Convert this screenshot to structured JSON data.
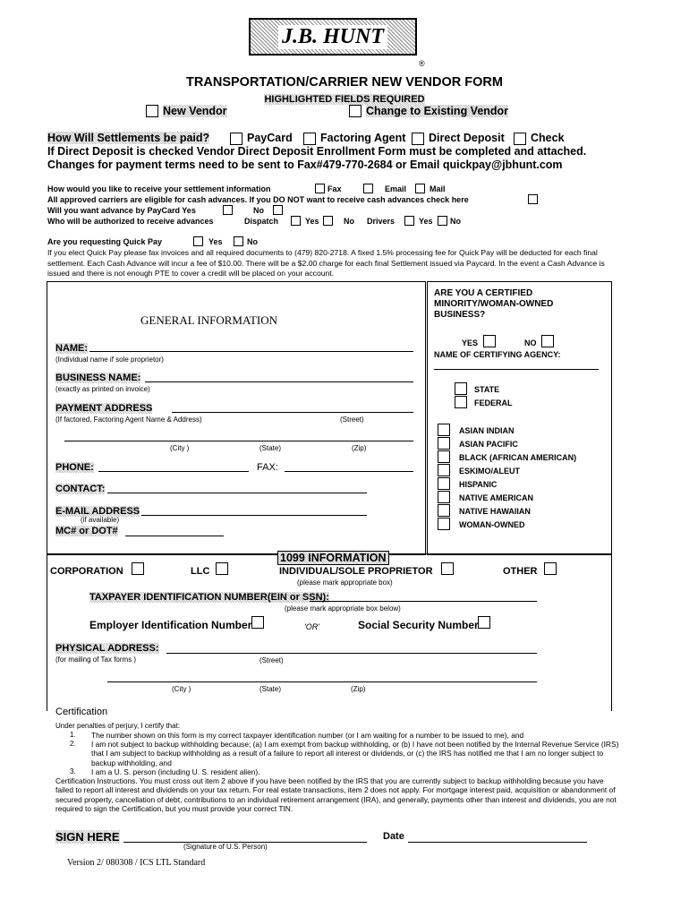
{
  "logo": {
    "text": "J.B. HUNT",
    "registered": "®"
  },
  "title": "TRANSPORTATION/CARRIER NEW VENDOR FORM",
  "highlighted_note": "HIGHLIGHTED FIELDS REQUIRED",
  "vendor_type": {
    "new": "New Vendor",
    "change": "Change to Existing Vendor"
  },
  "settlement": {
    "question": "How Will Settlements be paid?",
    "options": [
      "PayCard",
      "Factoring Agent",
      "Direct Deposit",
      "Check"
    ],
    "note1": "If Direct Deposit is checked Vendor Direct Deposit Enrollment Form must be completed and attached.",
    "note2": "Changes for payment terms need to be sent to Fax#479-770-2684 or Email quickpay@jbhunt.com"
  },
  "receive": {
    "question": "How would you like to receive your settlement information",
    "fax": "Fax",
    "email": "Email",
    "mail": "Mail"
  },
  "advances": {
    "line": "All approved carriers are eligible for cash advances. If you DO NOT want to receive cash advances check here",
    "paycard": "Will you want advance by PayCard  Yes",
    "no": "No",
    "authorized": "Who will be authorized to receive advances",
    "dispatch": "Dispatch",
    "yes": "Yes",
    "drivers": "Drivers"
  },
  "quickpay": {
    "question": "Are you requesting Quick Pay",
    "yes": "Yes",
    "no": "No",
    "text": "If you elect Quick Pay please fax invoices and all required documents to (479) 820-2718.  A fixed 1.5% processing fee for Quick Pay will be deducted for each final settlement.  Each Cash Advance will incur a fee of $10.00.  There will be a $2.00 charge for each final Settlement issued via Paycard.  In the event a Cash Advance is issued and there is not enough PTE to cover a credit will be placed on your account."
  },
  "general": {
    "heading": "GENERAL INFORMATION",
    "name": "NAME:",
    "name_hint": "(Individual name if sole proprietor)",
    "business": "BUSINESS NAME:",
    "business_hint": "(exactly as printed on invoice)",
    "payment": "PAYMENT ADDRESS",
    "payment_hint": "(If factored, Factoring Agent Name & Address)",
    "street": "(Street)",
    "city": "(City )",
    "state": "(State)",
    "zip": "(Zip)",
    "phone": "PHONE:",
    "fax": "FAX:",
    "contact": "CONTACT:",
    "email": "E-MAIL ADDRESS",
    "email_hint": "(if available)",
    "mc": "MC# or DOT#"
  },
  "minority": {
    "question": "ARE YOU A CERTIFIED MINORITY/WOMAN-OWNED BUSINESS?",
    "yes": "YES",
    "no": "NO",
    "agency": "NAME OF CERTIFYING AGENCY:",
    "levels": [
      "STATE",
      "FEDERAL"
    ],
    "groups": [
      "ASIAN INDIAN",
      "ASIAN PACIFIC",
      "BLACK (AFRICAN AMERICAN)",
      "ESKIMO/ALEUT",
      "HISPANIC",
      "NATIVE AMERICAN",
      "NATIVE HAWAIIAN",
      "WOMAN-OWNED"
    ]
  },
  "tax": {
    "heading": "1099 INFORMATION",
    "corp": "CORPORATION",
    "llc": "LLC",
    "individual": "INDIVIDUAL/SOLE PROPRIETOR",
    "other": "OTHER",
    "mark_hint": "(please mark appropriate box)",
    "tin": "TAXPAYER IDENTIFICATION NUMBER(EIN or SSN):",
    "tin_hint": "(please mark appropriate box below)",
    "ein": "Employer Identification Number",
    "or": "'OR'",
    "ssn": "Social Security Number",
    "physical": "PHYSICAL ADDRESS:",
    "physical_hint": "(for mailing of Tax forms )",
    "street": "(Street)",
    "city": "(City )",
    "state": "(State)",
    "zip": "(Zip)"
  },
  "certification": {
    "heading": "Certification",
    "intro": "Under penalties of perjury, I certify that:",
    "items": [
      "The number shown on this form is my correct taxpayer identification number (or I am waiting for a number to be issued to me), and",
      "I am not subject to backup withholding because; (a) I am exempt from backup withholding, or (b) I have not been notified by the Internal Revenue Service (IRS) that I am subject to backup withholding as a result of a failure to report all interest or dividends, or (c) the IRS has notified me that I am no longer subject to backup withholding, and",
      "I am a U. S. person (including U. S. resident alien)."
    ],
    "instructions": "Certification Instructions.  You must cross out item 2 above if you have been notified by the IRS that you are currently subject to backup withholding because you have failed to report all interest and dividends on your tax return.  For real estate transactions, item 2 does not apply.  For mortgage interest paid, acquisition or abandonment of secured property, cancellation of debt, contributions to an individual retirement arrangement (IRA), and generally, payments other than interest and dividends, you are not required to sign the Certification, but you must provide your correct TIN."
  },
  "signature": {
    "sign": "SIGN HERE",
    "hint": "(Signature of U.S. Person)",
    "date": "Date"
  },
  "version": "Version 2/ 080308 / ICS LTL Standard"
}
